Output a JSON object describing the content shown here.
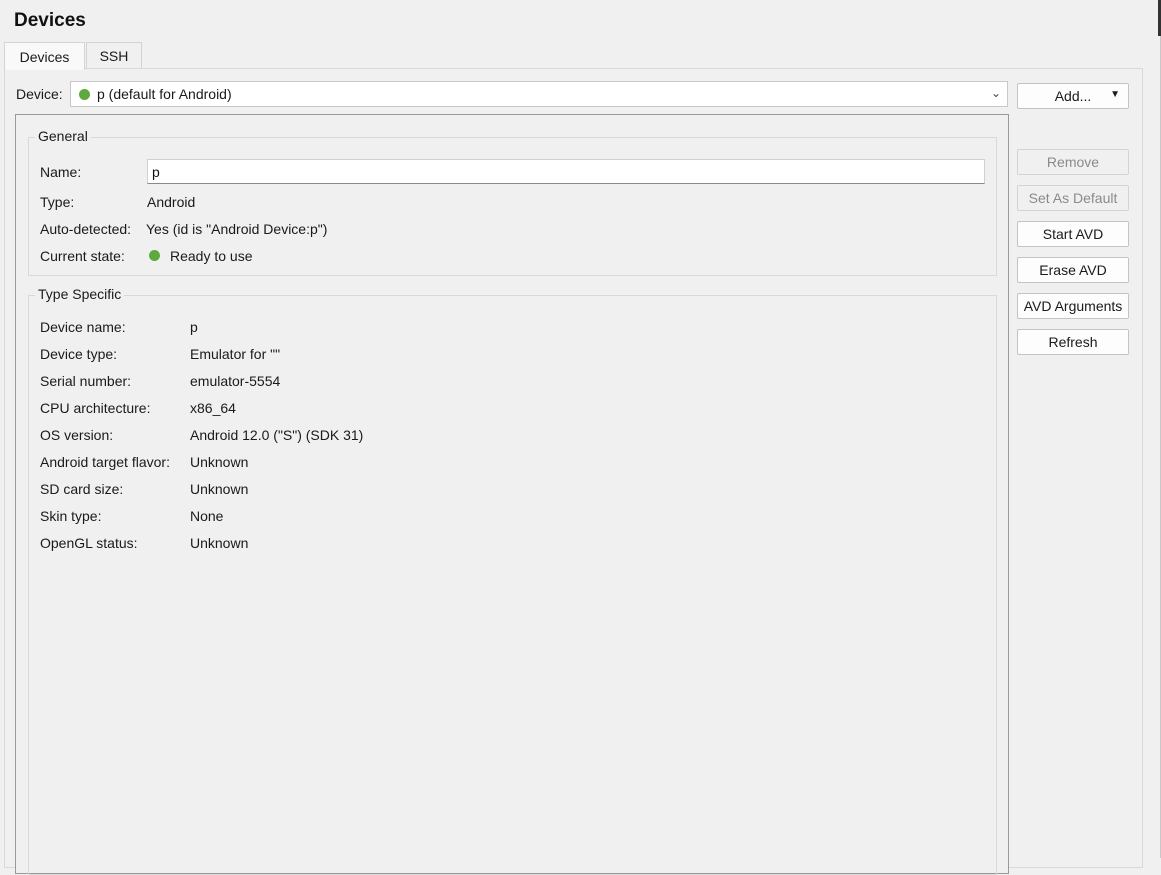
{
  "page_title": "Devices",
  "tabs": [
    {
      "label": "Devices",
      "active": true
    },
    {
      "label": "SSH",
      "active": false
    }
  ],
  "device_selector": {
    "label": "Device:",
    "value": "p (default for Android)",
    "status_color": "#5ea83f"
  },
  "buttons": {
    "add": "Add...",
    "remove": "Remove",
    "set_as_default": "Set As Default",
    "start_avd": "Start AVD",
    "erase_avd": "Erase AVD",
    "avd_arguments": "AVD Arguments",
    "refresh": "Refresh"
  },
  "general": {
    "title": "General",
    "name_label": "Name:",
    "name_value": "p",
    "type_label": "Type:",
    "type_value": "Android",
    "auto_detected_label": "Auto-detected:",
    "auto_detected_value": "Yes (id is \"Android Device:p\")",
    "current_state_label": "Current state:",
    "current_state_value": "Ready to use"
  },
  "type_specific": {
    "title": "Type Specific",
    "rows": [
      {
        "label": "Device name:",
        "value": "p"
      },
      {
        "label": "Device type:",
        "value": "Emulator for \"\""
      },
      {
        "label": "Serial number:",
        "value": "emulator-5554"
      },
      {
        "label": "CPU architecture:",
        "value": "x86_64"
      },
      {
        "label": "OS version:",
        "value": "Android 12.0 (\"S\") (SDK 31)"
      },
      {
        "label": "Android target flavor:",
        "value": "Unknown"
      },
      {
        "label": "SD card size:",
        "value": "Unknown"
      },
      {
        "label": "Skin type:",
        "value": "None"
      },
      {
        "label": "OpenGL status:",
        "value": "Unknown"
      }
    ]
  }
}
